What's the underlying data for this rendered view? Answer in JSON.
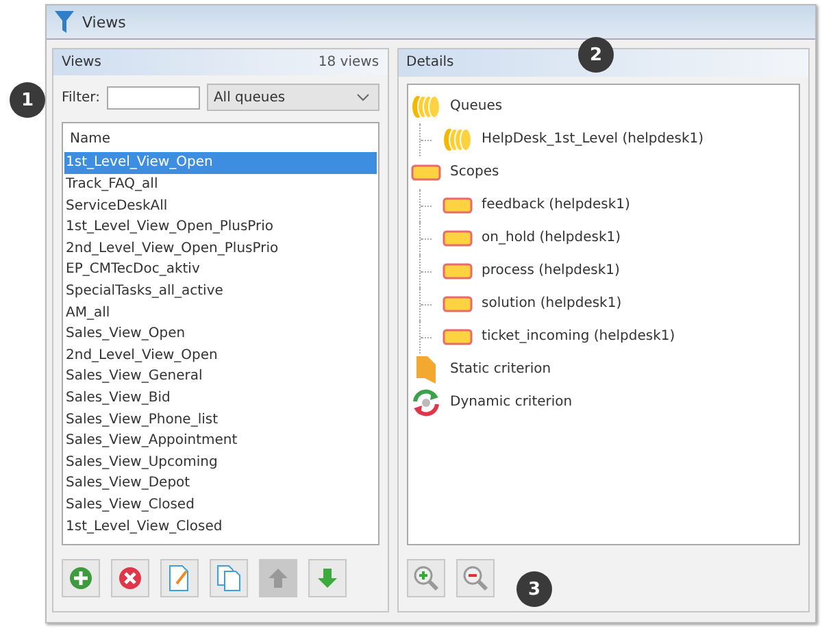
{
  "window": {
    "title": "Views"
  },
  "views_panel": {
    "title": "Views",
    "count": "18 views",
    "filter_label": "Filter:",
    "queue_select": "All queues",
    "column": "Name",
    "rows": [
      {
        "name": "1st_Level_View_Open",
        "selected": true
      },
      {
        "name": "Track_FAQ_all",
        "selected": false
      },
      {
        "name": "ServiceDeskAll",
        "selected": false
      },
      {
        "name": "1st_Level_View_Open_PlusPrio",
        "selected": false
      },
      {
        "name": "2nd_Level_View_Open_PlusPrio",
        "selected": false
      },
      {
        "name": "EP_CMTecDoc_aktiv",
        "selected": false
      },
      {
        "name": "SpecialTasks_all_active",
        "selected": false
      },
      {
        "name": "AM_all",
        "selected": false
      },
      {
        "name": "Sales_View_Open",
        "selected": false
      },
      {
        "name": "2nd_Level_View_Open",
        "selected": false
      },
      {
        "name": "Sales_View_General",
        "selected": false
      },
      {
        "name": "Sales_View_Bid",
        "selected": false
      },
      {
        "name": "Sales_View_Phone_list",
        "selected": false
      },
      {
        "name": "Sales_View_Appointment",
        "selected": false
      },
      {
        "name": "Sales_View_Upcoming",
        "selected": false
      },
      {
        "name": "Sales_View_Depot",
        "selected": false
      },
      {
        "name": "Sales_View_Closed",
        "selected": false
      },
      {
        "name": "1st_Level_View_Closed",
        "selected": false
      }
    ],
    "buttons": [
      {
        "kind": "add",
        "disabled": false
      },
      {
        "kind": "delete",
        "disabled": false
      },
      {
        "kind": "edit",
        "disabled": false
      },
      {
        "kind": "copy",
        "disabled": false
      },
      {
        "kind": "up",
        "disabled": true
      },
      {
        "kind": "down",
        "disabled": false
      }
    ]
  },
  "details_panel": {
    "title": "Details",
    "tree": [
      {
        "label": "Queues",
        "kind": "queue",
        "children": [
          {
            "label": "HelpDesk_1st_Level (helpdesk1)",
            "kind": "queue"
          }
        ]
      },
      {
        "label": "Scopes",
        "kind": "scope",
        "children": [
          {
            "label": "feedback (helpdesk1)",
            "kind": "scope"
          },
          {
            "label": "on_hold (helpdesk1)",
            "kind": "scope"
          },
          {
            "label": "process (helpdesk1)",
            "kind": "scope"
          },
          {
            "label": "solution (helpdesk1)",
            "kind": "scope"
          },
          {
            "label": "ticket_incoming (helpdesk1)",
            "kind": "scope"
          }
        ]
      },
      {
        "label": "Static criterion",
        "kind": "static"
      },
      {
        "label": "Dynamic criterion",
        "kind": "dynamic"
      }
    ],
    "buttons": [
      {
        "kind": "zoom-in",
        "disabled": false
      },
      {
        "kind": "zoom-out",
        "disabled": false
      }
    ]
  },
  "callouts": [
    "1",
    "2",
    "3"
  ]
}
